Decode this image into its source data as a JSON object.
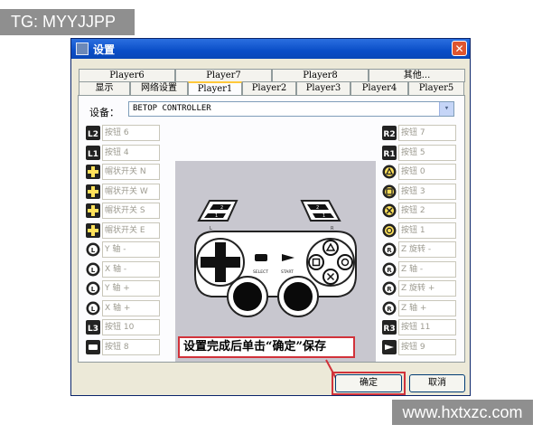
{
  "watermark_top": "TG: MYYJJPP",
  "watermark_bottom": "www.hxtxzc.com",
  "window": {
    "title": "设置",
    "close_glyph": "✕"
  },
  "tabs_row1": [
    "Player6",
    "Player7",
    "Player8",
    "其他..."
  ],
  "tabs_row2": [
    "显示",
    "网络设置",
    "Player1",
    "Player2",
    "Player3",
    "Player4",
    "Player5"
  ],
  "active_tab": "Player1",
  "device": {
    "label": "设备：",
    "value": "BETOP CONTROLLER",
    "arrow": "▾"
  },
  "left_mappings": [
    {
      "badge": "L2",
      "value": "按钮 6"
    },
    {
      "badge": "L1",
      "value": "按钮 4"
    },
    {
      "badge": "hat-up",
      "value": "帽状开关 N"
    },
    {
      "badge": "hat-left",
      "value": "帽状开关 W"
    },
    {
      "badge": "hat-down",
      "value": "帽状开关 S"
    },
    {
      "badge": "hat-right",
      "value": "帽状开关 E"
    },
    {
      "badge": "L-stick-up",
      "value": "Y 轴 -"
    },
    {
      "badge": "L-stick-left",
      "value": "X 轴 -"
    },
    {
      "badge": "L-stick-down",
      "value": "Y 轴 +"
    },
    {
      "badge": "L-stick-right",
      "value": "X 轴 +"
    },
    {
      "badge": "L3",
      "value": "按钮 10"
    },
    {
      "badge": "select",
      "value": "按钮 8"
    }
  ],
  "right_mappings": [
    {
      "badge": "R2",
      "value": "按钮 7"
    },
    {
      "badge": "R1",
      "value": "按钮 5"
    },
    {
      "badge": "triangle",
      "value": "按钮 0"
    },
    {
      "badge": "square",
      "value": "按钮 3"
    },
    {
      "badge": "cross",
      "value": "按钮 2"
    },
    {
      "badge": "circle",
      "value": "按钮 1"
    },
    {
      "badge": "R-stick-up",
      "value": "Z 旋转 -"
    },
    {
      "badge": "R-stick-left",
      "value": "Z 轴 -"
    },
    {
      "badge": "R-stick-down",
      "value": "Z 旋转 +"
    },
    {
      "badge": "R-stick-right",
      "value": "Z 轴 +"
    },
    {
      "badge": "R3",
      "value": "按钮 11"
    },
    {
      "badge": "start",
      "value": "按钮 9"
    }
  ],
  "pad_labels": {
    "select": "SELECT",
    "start": "START",
    "l_num_top": "2",
    "l_num_bot": "1",
    "r_num_top": "2",
    "r_num_bot": "1",
    "l_side": "L",
    "r_side": "R"
  },
  "annotation": "设置完成后单击“确定”保存",
  "buttons": {
    "ok": "确定",
    "cancel": "取消"
  }
}
